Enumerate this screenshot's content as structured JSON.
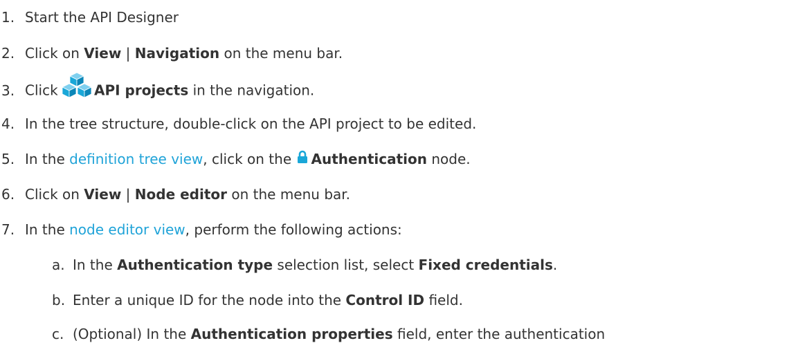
{
  "steps": [
    {
      "n": "1.",
      "t1": "Start the API Designer"
    },
    {
      "n": "2.",
      "t1": "Click on ",
      "b1": "View",
      "t2": " | ",
      "b2": "Navigation",
      "t3": " on the menu bar."
    },
    {
      "n": "3.",
      "t1": "Click ",
      "b1": "API projects",
      "t2": " in the navigation.",
      "icon": "cubes-icon"
    },
    {
      "n": "4.",
      "t1": "In the tree structure, double-click on the API project to be edited."
    },
    {
      "n": "5.",
      "t1": "In the ",
      "link": "definition tree view",
      "t2": ", click on the ",
      "b1": "Authentication",
      "t3": " node.",
      "icon": "lock-icon"
    },
    {
      "n": "6.",
      "t1": "Click on ",
      "b1": "View",
      "t2": " | ",
      "b2": "Node editor",
      "t3": " on the menu bar."
    },
    {
      "n": "7.",
      "t1": "In the ",
      "link": "node editor view",
      "t2": ", perform the following actions:"
    }
  ],
  "substeps": [
    {
      "n": "a.",
      "t1": "In the ",
      "b1": "Authentication type",
      "t2": " selection list, select ",
      "b2": "Fixed credentials",
      "t3": "."
    },
    {
      "n": "b.",
      "t1": "Enter a unique ID for the node into the ",
      "b1": "Control ID",
      "t2": " field."
    },
    {
      "n": "c.",
      "t1": "(Optional) In the ",
      "b1": "Authentication properties",
      "t2": " field, enter the authentication"
    }
  ],
  "colors": {
    "text": "#333333",
    "link": "#1fa3d8",
    "icon_blue": "#1aa7d8"
  }
}
